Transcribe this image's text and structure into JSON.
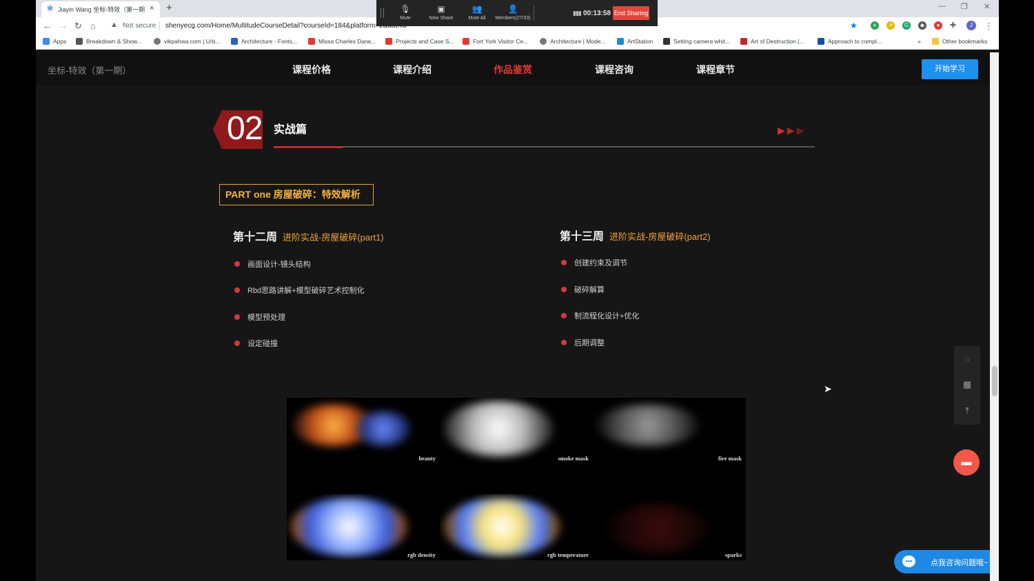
{
  "browser": {
    "tab_title": "Jiayin Wang 坐标-特效（第一期",
    "tab_close": "×",
    "new_tab": "+",
    "not_secure": "Not secure",
    "url": "shenyecg.com/Home/MultitudeCourseDetail?courseId=184&platform=2&authid",
    "bookmarks": [
      {
        "label": "Apps",
        "color": "#4285f4"
      },
      {
        "label": "Breakdown & Show...",
        "color": "#555555"
      },
      {
        "label": "vikpahwa.com | Urb...",
        "color": "#777777"
      },
      {
        "label": "Architecture - Fonts...",
        "color": "#2b63b8"
      },
      {
        "label": "Missa Charles Darw...",
        "color": "#e53935"
      },
      {
        "label": "Projects and Case S...",
        "color": "#e53935"
      },
      {
        "label": "Fort York Visitor Ce...",
        "color": "#e53935"
      },
      {
        "label": "Architecture | Mode...",
        "color": "#777777"
      },
      {
        "label": "ArtStation",
        "color": "#1d8bd6"
      },
      {
        "label": "Setting camera whit...",
        "color": "#333333"
      },
      {
        "label": "Art of Destruction (...",
        "color": "#c62828"
      },
      {
        "label": "Approach to compl...",
        "color": "#1a4fa0"
      }
    ],
    "bookmarks_more": "»",
    "other_bookmarks": "Other bookmarks",
    "profile_initial": "J"
  },
  "sharebar": {
    "mute": "Mute",
    "new_share": "New Share",
    "mute_all": "Mute All",
    "members": "Members(27/33)",
    "timer": "00:13:58",
    "end_sharing": "End Sharing"
  },
  "site": {
    "brand": "坐标-特效（第一期）",
    "nav": [
      "课程价格",
      "课程介绍",
      "作品鉴赏",
      "课程咨询",
      "课程章节"
    ],
    "active_nav_index": 2,
    "start_button": "开始学习",
    "accent_color": "#e53935",
    "button_color": "#1e90f0"
  },
  "section": {
    "number": "02",
    "title": "实战篇",
    "part_label": "PART one 房屋破碎：特效解析"
  },
  "weeks": [
    {
      "title": "第十二周",
      "subtitle": "进阶实战-房屋破碎(part1)",
      "items": [
        "画面设计-镜头结构",
        "Rbd思路讲解+模型破碎艺术控制化",
        "模型预处理",
        "设定碰撞"
      ]
    },
    {
      "title": "第十三周",
      "subtitle": "进阶实战-房屋破碎(part2)",
      "items": [
        "创建约束及调节",
        "破碎解算",
        "制流程化设计+优化",
        "后期调整"
      ]
    }
  ],
  "render_passes": [
    "beauty",
    "smoke mask",
    "fire mask",
    "rgb density",
    "rgb temperature",
    "sparks"
  ],
  "consult_label": "点我咨询问题哦~"
}
